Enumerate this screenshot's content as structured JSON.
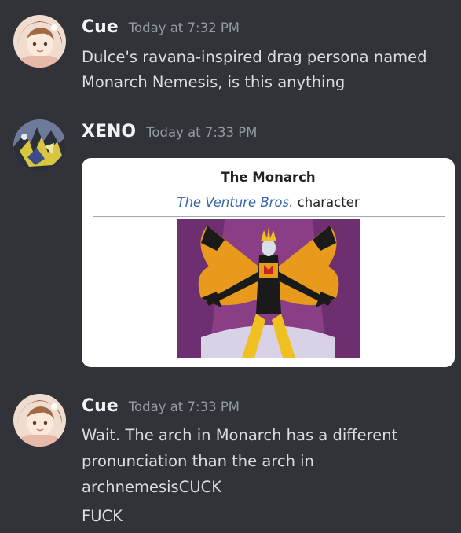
{
  "messages": [
    {
      "username": "Cue",
      "timestamp": "Today at 7:32 PM",
      "lines": [
        "Dulce's ravana-inspired drag persona named",
        "Monarch Nemesis, is this anything"
      ]
    },
    {
      "username": "XENO",
      "timestamp": "Today at 7:33 PM",
      "embed": {
        "title": "The Monarch",
        "subtitle_link": "The Venture Bros.",
        "subtitle_rest": " character"
      }
    },
    {
      "username": "Cue",
      "timestamp": "Today at 7:33 PM",
      "lines": [
        "Wait. The arch in Monarch has a different",
        "pronunciation than the arch in",
        "archnemesisCUCK",
        "FUCK"
      ]
    }
  ],
  "colors": {
    "background": "#313338",
    "username": "#f2f3f5",
    "timestamp": "#949ba4",
    "message_text": "#dbdee1",
    "embed_background": "#ffffff",
    "embed_link": "#3366aa"
  }
}
